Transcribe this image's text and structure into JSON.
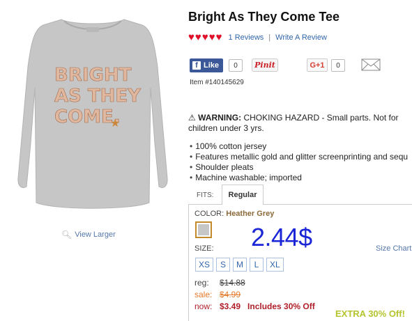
{
  "product": {
    "title": "Bright As They Come Tee",
    "image_text": [
      "BRIGHT",
      "AS THEY",
      "COME."
    ],
    "view_larger": "View Larger",
    "item_number": "Item #140145629"
  },
  "rating": {
    "stars": 5,
    "reviews_link": "1 Reviews",
    "separator": "|",
    "write_review": "Write A Review"
  },
  "social": {
    "fb_like": "Like",
    "fb_count": "0",
    "pinit": "Pinit",
    "gplus": "G+1",
    "gplus_count": "0",
    "icons": [
      "facebook-icon",
      "pinterest-icon",
      "google-plus-icon",
      "mail-icon"
    ]
  },
  "warning": {
    "symbol": "⚠",
    "label": "WARNING:",
    "text": "CHOKING HAZARD - Small parts. Not for children under 3 yrs."
  },
  "features": [
    "100% cotton jersey",
    "Features metallic gold and glitter screenprinting and sequ",
    "Shoulder pleats",
    "Machine washable; imported"
  ],
  "fit": {
    "label": "FITS:",
    "tabs": [
      "Regular"
    ]
  },
  "options": {
    "color_label": "COLOR:",
    "color_value": "Heather Grey",
    "size_label": "SIZE:",
    "size_chart": "Size Chart",
    "sizes": [
      "XS",
      "S",
      "M",
      "L",
      "XL"
    ]
  },
  "overlay_price": "2.44$",
  "prices": {
    "reg_label": "reg:",
    "reg_value": "$14.88",
    "sale_label": "sale:",
    "sale_value": "$4.99",
    "now_label": "now:",
    "now_value": "$3.49",
    "now_note": "Includes 30% Off"
  },
  "promo": "EXTRA 30% Off!",
  "colors": {
    "heart": "#e0102a",
    "link": "#3366aa",
    "sale": "#e47a2a",
    "now": "#b0202a",
    "overlay": "#1a25d6",
    "promo": "#b5c42e",
    "shirt": "#c6c6c6"
  }
}
